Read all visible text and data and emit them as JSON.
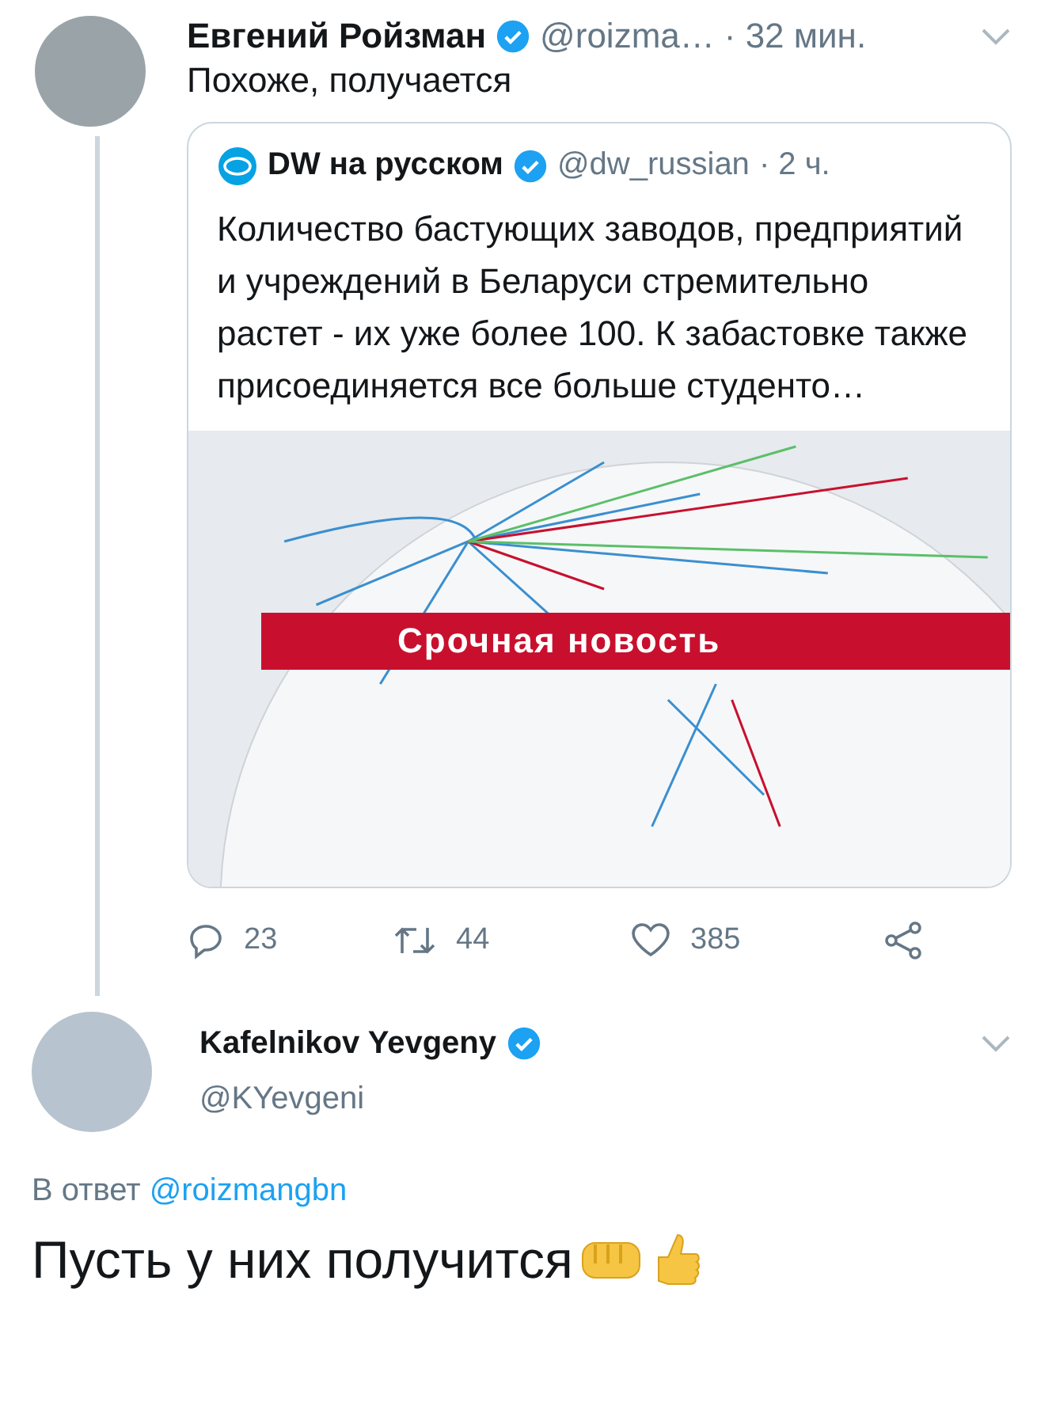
{
  "tweet": {
    "name": "Евгений Ройзман",
    "verified": true,
    "handle": "@roizma…",
    "time": "· 32 мин.",
    "text": "Похоже, получается",
    "quote": {
      "name": "DW на русском",
      "verified": true,
      "handle": "@dw_russian",
      "time": "· 2 ч.",
      "text": "Количество бастующих заводов, предприятий и учреждений в Беларуси стремительно растет - их уже более 100. К забастовке также присоединяется все больше студенто…",
      "image": {
        "banner": "Срочная новость"
      }
    },
    "actions": [
      {
        "kind": "reply",
        "count": "23"
      },
      {
        "kind": "retweet",
        "count": "44"
      },
      {
        "kind": "like",
        "count": "385"
      },
      {
        "kind": "share"
      }
    ]
  },
  "reply": {
    "name": "Kafelnikov Yevgeny",
    "verified": true,
    "handle": "@KYevgeni",
    "reply_prefix": "В ответ",
    "reply_to": "@roizmangbn",
    "text": "Пусть у них получится"
  }
}
